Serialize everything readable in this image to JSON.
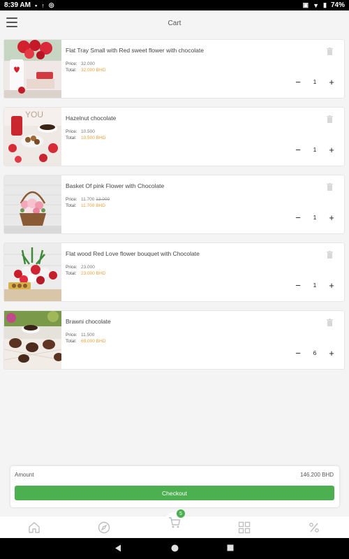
{
  "status_bar": {
    "time": "8:39 AM",
    "battery": "74%"
  },
  "header": {
    "title": "Cart"
  },
  "labels": {
    "price": "Price:",
    "total": "Total:"
  },
  "items": [
    {
      "name": "Flat Tray Small  with Red sweet flower with chocolate",
      "price": "32.000",
      "old_price": "",
      "total": "32.000 BHD",
      "qty": "1"
    },
    {
      "name": "Hazelnut chocolate",
      "price": "10.500",
      "old_price": "",
      "total": "10.500 BHD",
      "qty": "1"
    },
    {
      "name": "Basket Of pink Flower with Chocolate",
      "price": "11.700",
      "old_price": "13.000",
      "total": "11.700 BHD",
      "qty": "1"
    },
    {
      "name": "Flat wood Red Love flower bouquet with Chocolate",
      "price": "23.000",
      "old_price": "",
      "total": "23.000 BHD",
      "qty": "1"
    },
    {
      "name": "Brawni chocolate",
      "price": "11.500",
      "old_price": "",
      "total": "69.000 BHD",
      "qty": "6"
    }
  ],
  "summary": {
    "amount_label": "Amount",
    "amount_value": "146.200 BHD",
    "checkout_label": "Checkout"
  },
  "nav": {
    "cart_count": "5",
    "icons": [
      "home-icon",
      "compass-icon",
      "cart-icon",
      "grid-icon",
      "percent-icon"
    ]
  },
  "colors": {
    "accent": "#4caf50",
    "total": "#e8a13a",
    "background": "#f4f4f4"
  }
}
